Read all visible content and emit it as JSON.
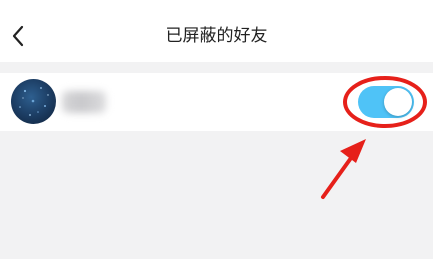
{
  "header": {
    "title": "已屏蔽的好友",
    "back_icon": "chevron-left-icon"
  },
  "blocked_friends": [
    {
      "name": "",
      "avatar": "avatar",
      "blocked": true
    }
  ],
  "colors": {
    "toggle_on": "#4fc3f7",
    "annotation_red": "#e6201a",
    "background": "#f2f2f3"
  }
}
